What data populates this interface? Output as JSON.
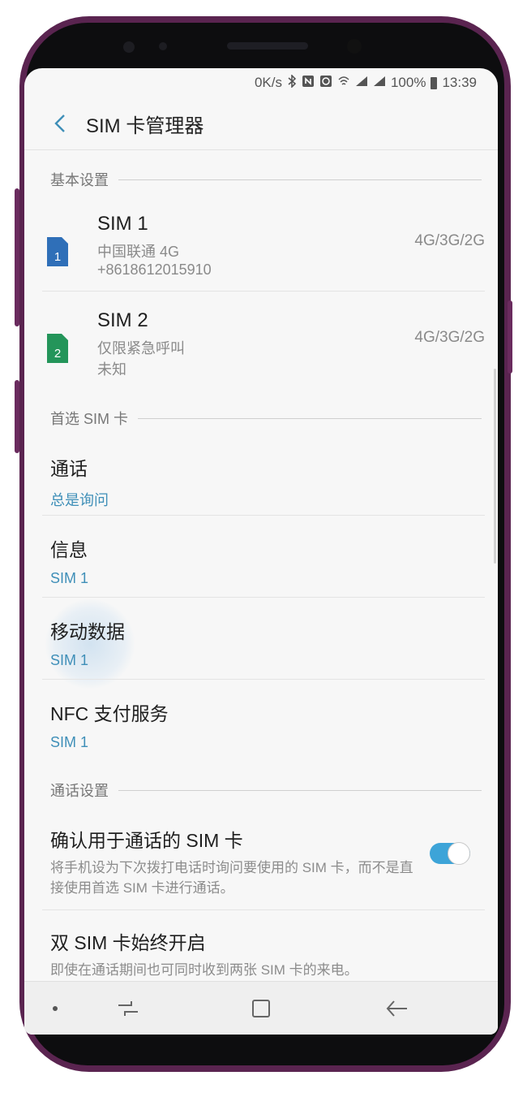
{
  "status_bar": {
    "speed": "0K/s",
    "icons": [
      "bluetooth-icon",
      "nfc-icon",
      "alarm-icon",
      "wifi-signal-icon",
      "cell-signal-icon",
      "cell-signal-icon"
    ],
    "battery": "100%",
    "time": "13:39"
  },
  "header": {
    "title": "SIM 卡管理器"
  },
  "sections": {
    "basic": "基本设置",
    "preferred": "首选 SIM 卡",
    "call_settings": "通话设置"
  },
  "sims": [
    {
      "name": "SIM 1",
      "carrier": "中国联通 4G",
      "number": "+8618612015910",
      "network": "4G/3G/2G",
      "badge": "1",
      "color": "#2f6fb8"
    },
    {
      "name": "SIM 2",
      "carrier": "仅限紧急呼叫",
      "number": "未知",
      "network": "4G/3G/2G",
      "badge": "2",
      "color": "#24955a"
    }
  ],
  "preferred": [
    {
      "title": "通话",
      "value": "总是询问"
    },
    {
      "title": "信息",
      "value": "SIM 1"
    },
    {
      "title": "移动数据",
      "value": "SIM 1"
    },
    {
      "title": "NFC 支付服务",
      "value": "SIM 1"
    }
  ],
  "call_settings": {
    "confirm": {
      "title": "确认用于通话的 SIM 卡",
      "desc": "将手机设为下次拨打电话时询问要使用的 SIM 卡，而不是直接使用首选 SIM 卡进行通话。",
      "enabled": true
    },
    "dual": {
      "title": "双 SIM 卡始终开启",
      "desc": "即使在通话期间也可同时收到两张 SIM 卡的来电。"
    }
  },
  "colors": {
    "accent": "#3f8fb8",
    "toggle": "#3da4d8",
    "phone_frame": "#5a2450"
  },
  "nav": [
    "dot-icon",
    "recent-apps-icon",
    "home-icon",
    "back-icon"
  ]
}
